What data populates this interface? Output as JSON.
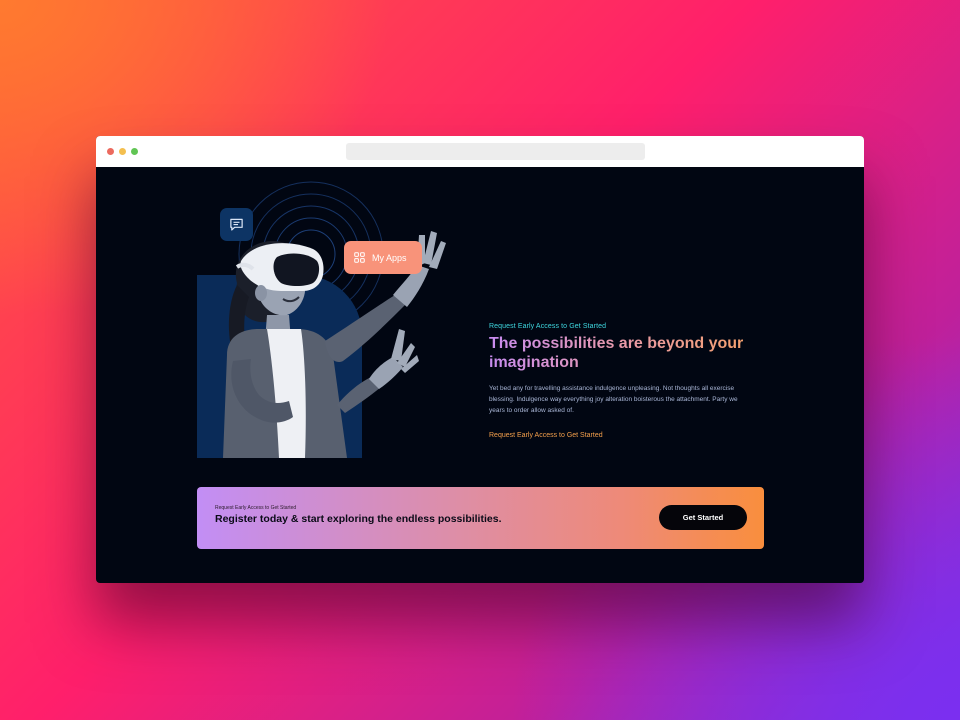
{
  "hero": {
    "badge_label": "My Apps",
    "eyebrow": "Request Early Access to Get Started",
    "headline": "The possibilities are beyond your imagination",
    "body": "Yet bed any for travelling assistance indulgence unpleasing. Not thoughts all exercise blessing. Indulgence way everything joy alteration boisterous the attachment. Party we years to order allow asked of.",
    "cta_label": "Request Early Access to Get Started"
  },
  "banner": {
    "eyebrow": "Request Early Access to Get Started",
    "title": "Register today & start exploring the endless possibilities.",
    "button_label": "Get Started"
  },
  "icons": {
    "chat_badge": "chat-icon",
    "apps_badge": "grid-icon"
  },
  "colors": {
    "page_bg": "#010612",
    "accent_cyan": "#3fd8e0",
    "accent_orange": "#f5a04c",
    "badge_peach": "#f8937a",
    "panel_blue": "#0a2b58",
    "gradient_start": "#c28ef5",
    "gradient_end": "#f98e3d"
  }
}
